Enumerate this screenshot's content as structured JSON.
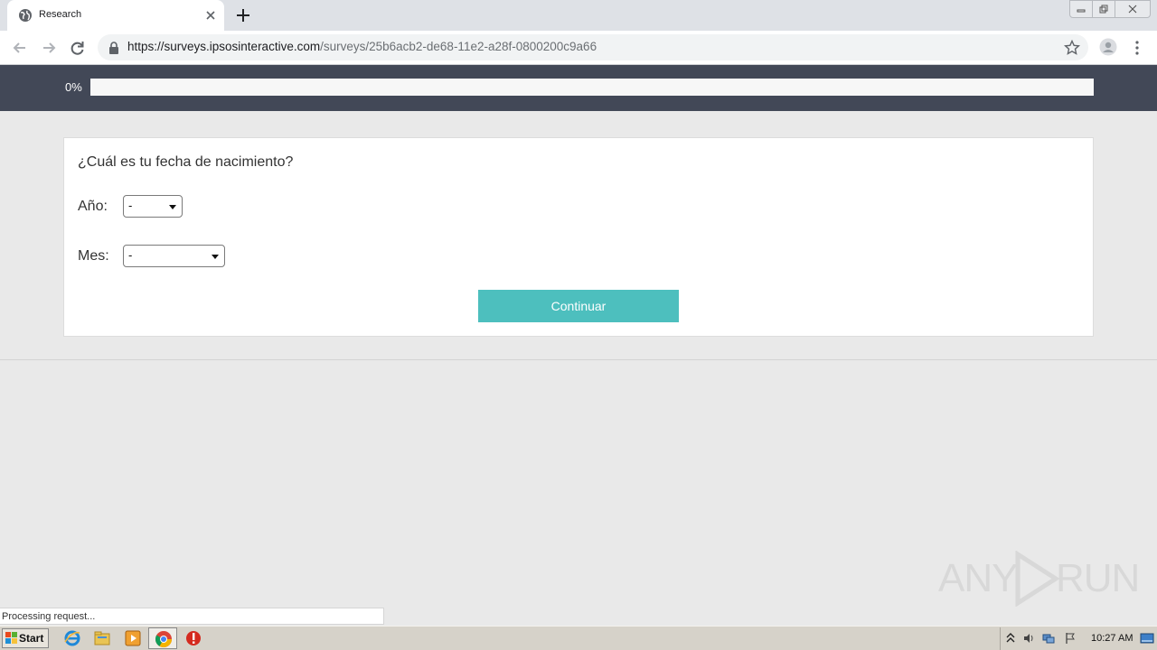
{
  "browser": {
    "tab_title": "Research",
    "url_host": "https://surveys.ipsosinteractive.com",
    "url_path": "/surveys/25b6acb2-de68-11e2-a28f-0800200c9a66",
    "status_text": "Processing request..."
  },
  "survey": {
    "progress_label": "0%",
    "progress_value": 0,
    "question": "¿Cuál es tu fecha de nacimiento?",
    "year_label": "Año:",
    "year_value": "-",
    "month_label": "Mes:",
    "month_value": "-",
    "continue_label": "Continuar"
  },
  "watermark": {
    "left": "ANY",
    "right": "RUN"
  },
  "taskbar": {
    "start_label": "Start",
    "clock": "10:27 AM",
    "apps": [
      "internet-explorer-icon",
      "file-explorer-icon",
      "media-player-icon",
      "chrome-icon",
      "stop-icon"
    ]
  },
  "colors": {
    "header_bg": "#424857",
    "accent": "#4dbfbe",
    "page_bg": "#e9e9e9"
  }
}
